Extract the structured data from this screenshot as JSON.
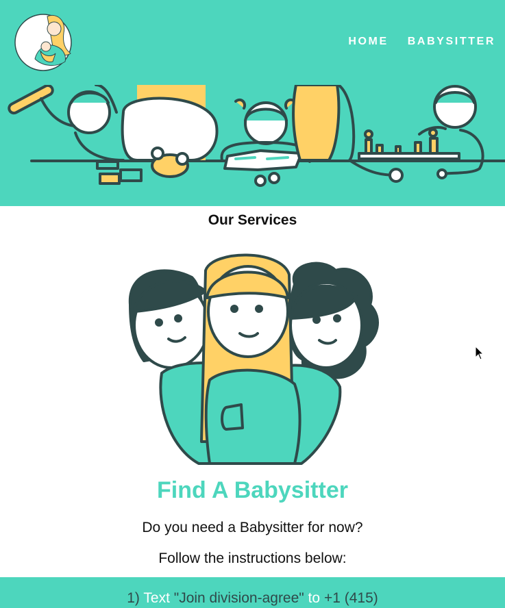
{
  "nav": {
    "home_label": "HOME",
    "babysitter_label": "BABYSITTER"
  },
  "services": {
    "title": "Our Services"
  },
  "find": {
    "title": "Find A Babysitter",
    "question": "Do you need a Babysitter for now?",
    "follow": "Follow the instructions below:"
  },
  "instructions": {
    "step_prefix": "1) ",
    "text_word": "Text",
    "code": " \"Join division-agree\" ",
    "to_word": "to",
    "number": " +1 (415)"
  },
  "colors": {
    "brand": "#4dd6bd",
    "accent_yellow": "#ffd166",
    "outline": "#2f4a4a",
    "title_text": "#4dd6bd"
  },
  "icons": {
    "logo": "mother-baby-logo-icon",
    "cursor": "mouse-pointer-icon"
  }
}
